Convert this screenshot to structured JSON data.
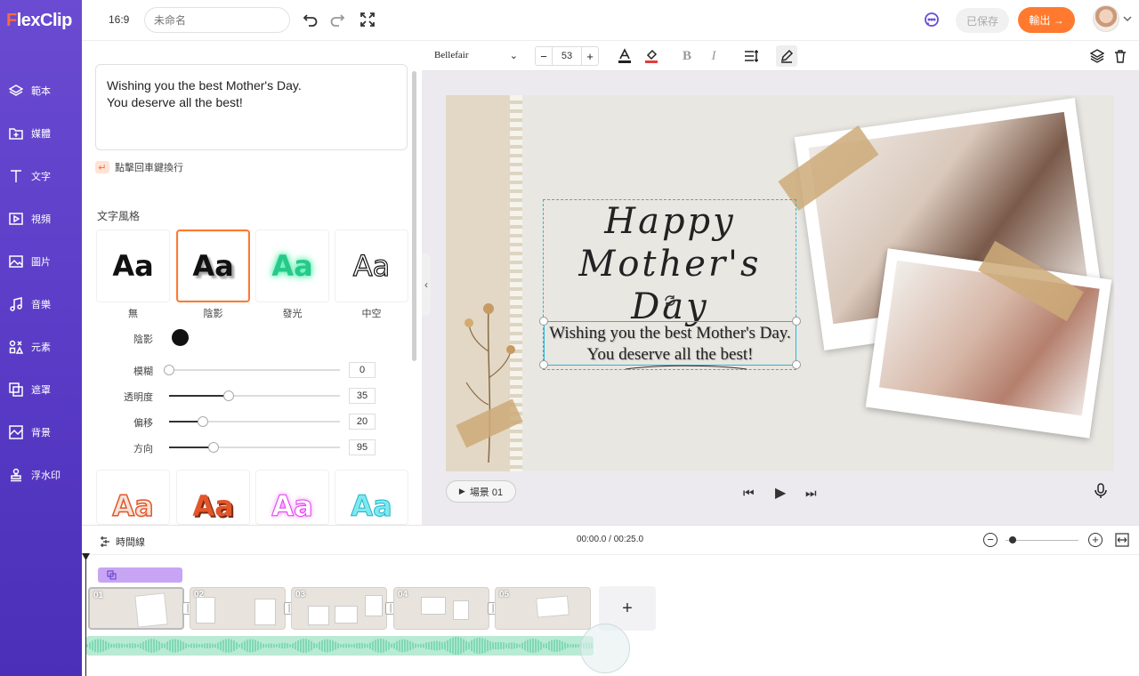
{
  "app": {
    "logo_text": "FlexClip",
    "logo_first": "F",
    "logo_rest": "lexClip"
  },
  "sidebar": {
    "items": [
      {
        "label": "範本",
        "icon": "layers-icon"
      },
      {
        "label": "媒體",
        "icon": "folder-icon"
      },
      {
        "label": "文字",
        "icon": "text-icon"
      },
      {
        "label": "視頻",
        "icon": "video-icon"
      },
      {
        "label": "圖片",
        "icon": "image-icon"
      },
      {
        "label": "音樂",
        "icon": "music-icon"
      },
      {
        "label": "元素",
        "icon": "elements-icon"
      },
      {
        "label": "遮罩",
        "icon": "overlay-icon"
      },
      {
        "label": "背景",
        "icon": "background-icon"
      },
      {
        "label": "浮水印",
        "icon": "stamp-icon"
      }
    ]
  },
  "header": {
    "aspect_ratio": "16:9",
    "title_placeholder": "未命名",
    "saved_label": "已保存",
    "export_label": "輸出 →"
  },
  "text_panel": {
    "text_value_line1": "Wishing you the best Mother's Day.",
    "text_value_line2": "You deserve all the best!",
    "enter_key": "↵",
    "hint": "點擊回車鍵換行",
    "styles_title": "文字風格",
    "styles": [
      {
        "label": "無",
        "sample": "Aa"
      },
      {
        "label": "陰影",
        "sample": "Aa"
      },
      {
        "label": "發光",
        "sample": "Aa"
      },
      {
        "label": "中空",
        "sample": "Aa"
      }
    ],
    "more_styles": [
      "Aa",
      "Aa",
      "Aa",
      "Aa"
    ],
    "shadow_label": "陰影",
    "shadow_color": "#111111",
    "properties": [
      {
        "label": "模糊",
        "value": "0",
        "fraction": 0.0
      },
      {
        "label": "透明度",
        "value": "35",
        "fraction": 0.35
      },
      {
        "label": "偏移",
        "value": "20",
        "fraction": 0.2
      },
      {
        "label": "方向",
        "value": "95",
        "fraction": 0.26
      }
    ]
  },
  "format_toolbar": {
    "font": "Bellefair",
    "size_minus": "−",
    "size": "53",
    "size_plus": "+",
    "bold": "B",
    "italic": "I"
  },
  "stage": {
    "title_line1": "Happy",
    "title_line2": "Mother's Day",
    "subtitle_line1": "Wishing you the best Mother's Day.",
    "subtitle_line2": "You deserve all the best!"
  },
  "player": {
    "scene_label": "場景 01",
    "prev": "⏮",
    "play": "▶",
    "next": "⏭"
  },
  "timeline": {
    "label": "時間線",
    "time": "00:00.0 / 00:25.0",
    "zoom_out": "−",
    "zoom_in": "+",
    "zoom_level": 0.1,
    "clips": [
      "01",
      "02",
      "03",
      "04",
      "05"
    ],
    "add_label": "+"
  },
  "colors": {
    "accent": "#ff7a2f",
    "sidebar": "#5a3cc7",
    "selection": "#29b6d6",
    "audio": "#7fd9b5"
  }
}
